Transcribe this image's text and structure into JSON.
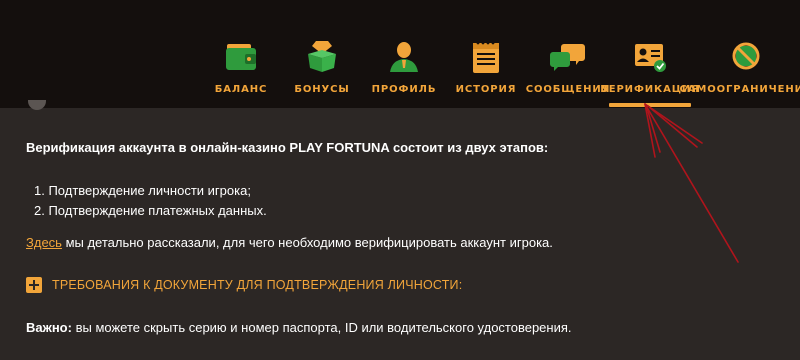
{
  "nav": {
    "items": [
      {
        "label": "БАЛАНС",
        "icon": "wallet-icon"
      },
      {
        "label": "БОНУСЫ",
        "icon": "gift-diamond-icon"
      },
      {
        "label": "ПРОФИЛЬ",
        "icon": "user-profile-icon"
      },
      {
        "label": "ИСТОРИЯ",
        "icon": "notepad-history-icon"
      },
      {
        "label": "СООБЩЕНИЯ",
        "icon": "chat-bubbles-icon"
      },
      {
        "label": "ВЕРИФИКАЦИЯ",
        "icon": "id-card-check-icon"
      },
      {
        "label": "САМООГРАНИЧЕНИЯ",
        "icon": "no-entry-icon"
      }
    ],
    "active_index": 5
  },
  "content": {
    "intro": "Верификация аккаунта в онлайн-казино PLAY FORTUNA состоит из двух этапов:",
    "steps": [
      "1. Подтверждение личности игрока;",
      "2. Подтверждение платежных данных."
    ],
    "here_link": "Здесь",
    "here_text": " мы детально рассказали, для чего необходимо верифицировать аккаунт игрока.",
    "accordion_title": "ТРЕБОВАНИЯ К ДОКУМЕНТУ ДЛЯ ПОДТВЕРЖДЕНИЯ ЛИЧНОСТИ:",
    "important_label": "Важно:",
    "important_text": " вы можете скрыть серию и номер паспорта, ID или водительского удостоверения."
  },
  "colors": {
    "accent": "#f2a53a",
    "icon_green": "#2f9b3d",
    "header_bg": "#140f0d",
    "content_bg": "#2c2725",
    "annotation_red": "#b0141c"
  }
}
